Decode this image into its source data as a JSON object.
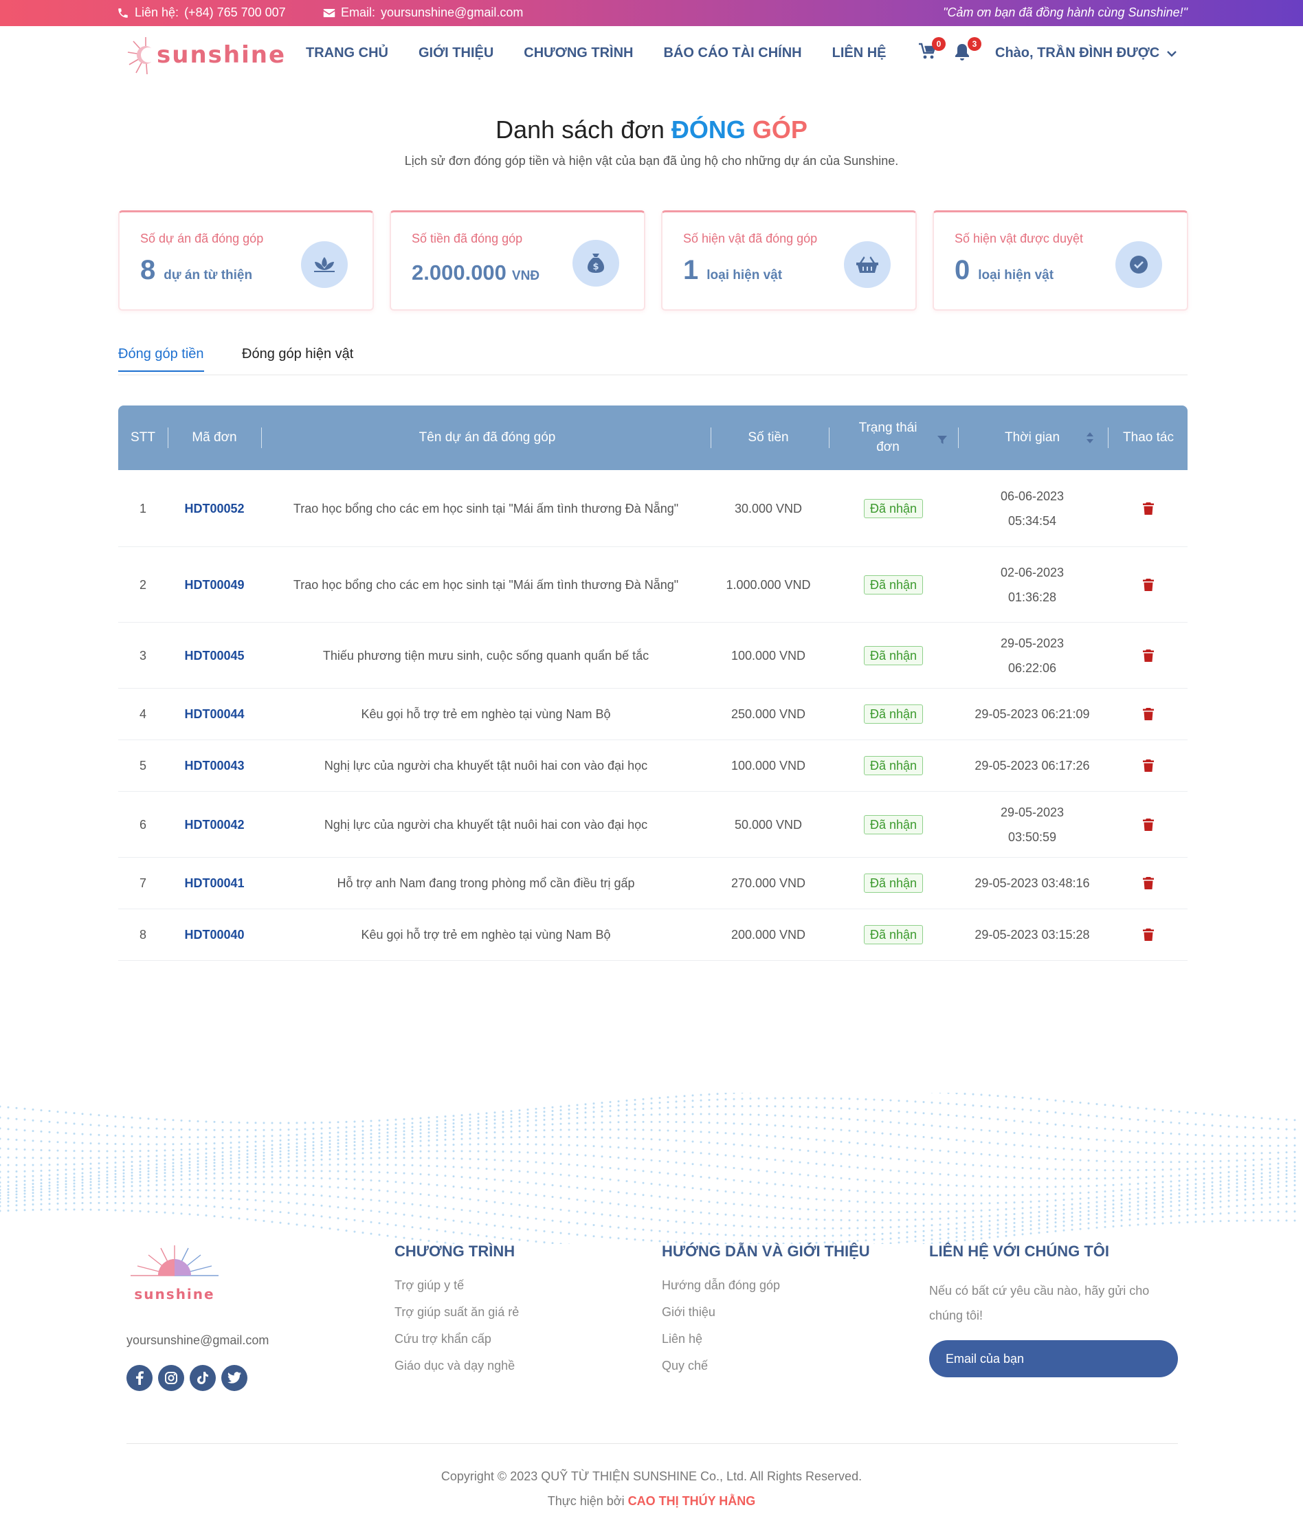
{
  "topbar": {
    "phone_label": "Liên hệ:",
    "phone": "(+84) 765 700 007",
    "email_label": "Email:",
    "email": "yoursunshine@gmail.com",
    "quote": "\"Cảm ơn bạn đã đồng hành cùng Sunshine!\""
  },
  "header": {
    "logo_text": "sunshine",
    "nav": [
      "TRANG CHỦ",
      "GIỚI THIỆU",
      "CHƯƠNG TRÌNH",
      "BÁO CÁO TÀI CHÍNH",
      "LIÊN HỆ"
    ],
    "cart_count": "0",
    "notification_count": "3",
    "greeting": "Chào, TRẦN ĐÌNH ĐƯỢC"
  },
  "page": {
    "title_1": "Danh sách đơn",
    "title_2": "ĐÓNG",
    "title_3": "GÓP",
    "subtitle": "Lịch sử đơn đóng góp tiền và hiện vật của bạn đã ủng hộ cho những dự án của Sunshine."
  },
  "stats": [
    {
      "title": "Số dự án đã đóng góp",
      "value": "8",
      "unit": "dự án từ thiện",
      "icon": "lotus-icon"
    },
    {
      "title": "Số tiền đã đóng góp",
      "value": "2.000.000",
      "unit": "VNĐ",
      "icon": "money-bag-icon"
    },
    {
      "title": "Số hiện vật đã đóng góp",
      "value": "1",
      "unit": "loại hiện vật",
      "icon": "basket-icon"
    },
    {
      "title": "Số hiện vật được duyệt",
      "value": "0",
      "unit": "loại hiện vật",
      "icon": "check-circle-icon"
    }
  ],
  "tabs": [
    "Đóng góp tiền",
    "Đóng góp hiện vật"
  ],
  "table": {
    "headers": [
      "STT",
      "Mã đơn",
      "Tên dự án đã đóng góp",
      "Số tiền",
      "Trạng thái đơn",
      "Thời gian",
      "Thao tác"
    ],
    "rows": [
      {
        "stt": "1",
        "code": "HDT00052",
        "project": "Trao học bổng cho các em học sinh tại \"Mái ấm tình thương Đà Nẵng\"",
        "amount": "30.000 VND",
        "status": "Đã nhận",
        "time": "06-06-2023 05:34:54"
      },
      {
        "stt": "2",
        "code": "HDT00049",
        "project": "Trao học bổng cho các em học sinh tại \"Mái ấm tình thương Đà Nẵng\"",
        "amount": "1.000.000 VND",
        "status": "Đã nhận",
        "time": "02-06-2023 01:36:28"
      },
      {
        "stt": "3",
        "code": "HDT00045",
        "project": "Thiếu phương tiện mưu sinh, cuộc sống quanh quẩn bế tắc",
        "amount": "100.000 VND",
        "status": "Đã nhận",
        "time": "29-05-2023 06:22:06"
      },
      {
        "stt": "4",
        "code": "HDT00044",
        "project": "Kêu gọi hỗ trợ trẻ em nghèo tại vùng Nam Bộ",
        "amount": "250.000 VND",
        "status": "Đã nhận",
        "time": "29-05-2023 06:21:09"
      },
      {
        "stt": "5",
        "code": "HDT00043",
        "project": "Nghị lực của người cha khuyết tật nuôi hai con vào đại học",
        "amount": "100.000 VND",
        "status": "Đã nhận",
        "time": "29-05-2023 06:17:26"
      },
      {
        "stt": "6",
        "code": "HDT00042",
        "project": "Nghị lực của người cha khuyết tật nuôi hai con vào đại học",
        "amount": "50.000 VND",
        "status": "Đã nhận",
        "time": "29-05-2023 03:50:59"
      },
      {
        "stt": "7",
        "code": "HDT00041",
        "project": "Hỗ trợ anh Nam đang trong phòng mổ cần điều trị gấp",
        "amount": "270.000 VND",
        "status": "Đã nhận",
        "time": "29-05-2023 03:48:16"
      },
      {
        "stt": "8",
        "code": "HDT00040",
        "project": "Kêu gọi hỗ trợ trẻ em nghèo tại vùng Nam Bộ",
        "amount": "200.000 VND",
        "status": "Đã nhận",
        "time": "29-05-2023 03:15:28"
      }
    ]
  },
  "footer": {
    "logo_text": "sunshine",
    "email": "yoursunshine@gmail.com",
    "socials": [
      "facebook-icon",
      "instagram-icon",
      "tiktok-icon",
      "twitter-icon"
    ],
    "col1": {
      "title": "CHƯƠNG TRÌNH",
      "links": [
        "Trợ giúp y tế",
        "Trợ giúp suất ăn giá rẻ",
        "Cứu trợ khẩn cấp",
        "Giáo dục và dạy nghề"
      ]
    },
    "col2": {
      "title": "HƯỚNG DẪN VÀ GIỚI THIỆU",
      "links": [
        "Hướng dẫn đóng góp",
        "Giới thiệu",
        "Liên hệ",
        "Quy chế"
      ]
    },
    "col3": {
      "title": "LIÊN HỆ VỚI CHÚNG TÔI",
      "text": "Nếu có bất cứ yêu cầu nào, hãy gửi cho chúng tôi!",
      "input_placeholder": "Email của bạn"
    },
    "copyright": "Copyright © 2023 QUỸ TỪ THIỆN SUNSHINE Co., Ltd. All Rights Reserved.",
    "made_by_label": "Thực hiện bởi",
    "made_by": "CAO THỊ THÚY HẰNG"
  },
  "colors": {
    "brand_blue": "#3d5a8a",
    "accent_pink": "#f26c6c",
    "table_header": "#7aa0c7",
    "status_green": "#3c9a2e",
    "delete_red": "#c0201e"
  }
}
